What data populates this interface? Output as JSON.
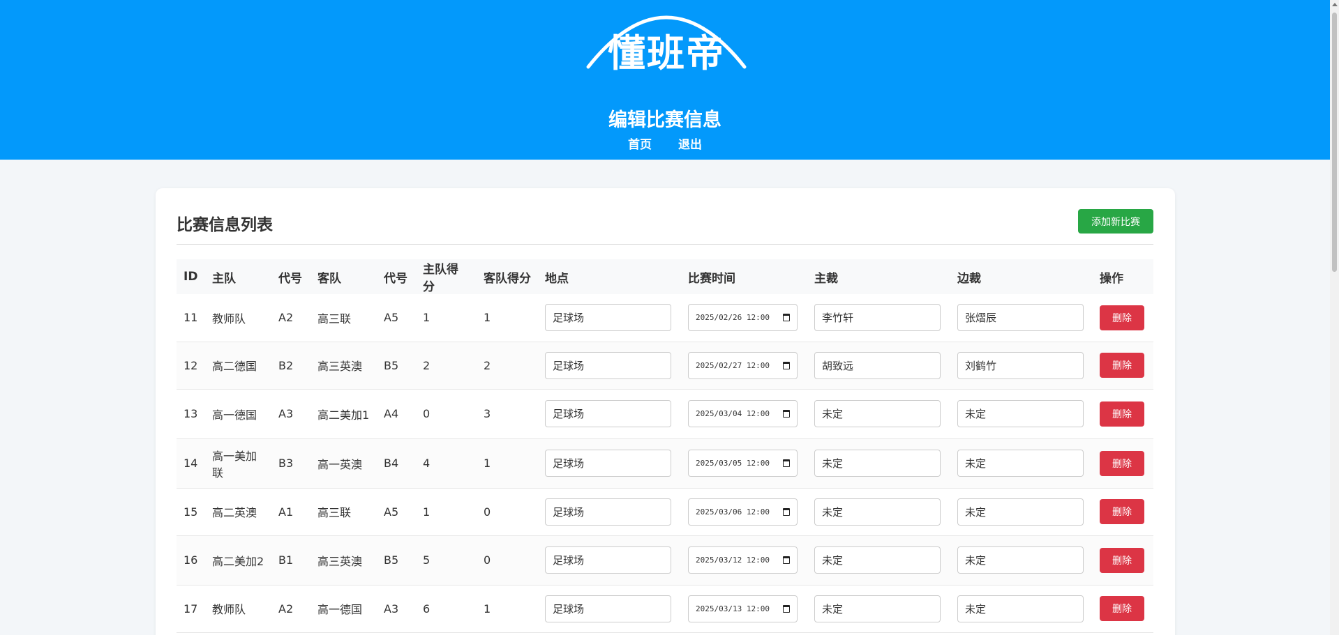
{
  "header": {
    "logo": "懂班帝",
    "title": "编辑比赛信息",
    "nav": [
      "首页",
      "退出"
    ]
  },
  "colors": {
    "header_bg": "#0399fb",
    "add_button": "#28a745",
    "delete_button": "#dc3545"
  },
  "card": {
    "title": "比赛信息列表",
    "add_button": "添加新比赛"
  },
  "table": {
    "columns": [
      "ID",
      "主队",
      "代号",
      "客队",
      "代号",
      "主队得分",
      "客队得分",
      "地点",
      "比赛时间",
      "主裁",
      "边裁",
      "操作"
    ],
    "delete_label": "删除",
    "rows": [
      {
        "id": "11",
        "home": "教师队",
        "home_code": "A2",
        "away": "高三联",
        "away_code": "A5",
        "home_score": "1",
        "away_score": "1",
        "venue": "足球场",
        "time": "2025/02/26 12:00",
        "referee": "李竹轩",
        "linesman": "张熠辰"
      },
      {
        "id": "12",
        "home": "高二德国",
        "home_code": "B2",
        "away": "高三英澳",
        "away_code": "B5",
        "home_score": "2",
        "away_score": "2",
        "venue": "足球场",
        "time": "2025/02/27 12:00",
        "referee": "胡致远",
        "linesman": "刘鹤竹"
      },
      {
        "id": "13",
        "home": "高一德国",
        "home_code": "A3",
        "away": "高二美加1",
        "away_code": "A4",
        "home_score": "0",
        "away_score": "3",
        "venue": "足球场",
        "time": "2025/03/04 12:00",
        "referee": "未定",
        "linesman": "未定"
      },
      {
        "id": "14",
        "home": "高一美加联",
        "home_code": "B3",
        "away": "高一英澳",
        "away_code": "B4",
        "home_score": "4",
        "away_score": "1",
        "venue": "足球场",
        "time": "2025/03/05 12:00",
        "referee": "未定",
        "linesman": "未定"
      },
      {
        "id": "15",
        "home": "高二英澳",
        "home_code": "A1",
        "away": "高三联",
        "away_code": "A5",
        "home_score": "1",
        "away_score": "0",
        "venue": "足球场",
        "time": "2025/03/06 12:00",
        "referee": "未定",
        "linesman": "未定"
      },
      {
        "id": "16",
        "home": "高二美加2",
        "home_code": "B1",
        "away": "高三英澳",
        "away_code": "B5",
        "home_score": "5",
        "away_score": "0",
        "venue": "足球场",
        "time": "2025/03/12 12:00",
        "referee": "未定",
        "linesman": "未定"
      },
      {
        "id": "17",
        "home": "教师队",
        "home_code": "A2",
        "away": "高一德国",
        "away_code": "A3",
        "home_score": "6",
        "away_score": "1",
        "venue": "足球场",
        "time": "2025/03/13 12:00",
        "referee": "未定",
        "linesman": "未定"
      }
    ]
  }
}
